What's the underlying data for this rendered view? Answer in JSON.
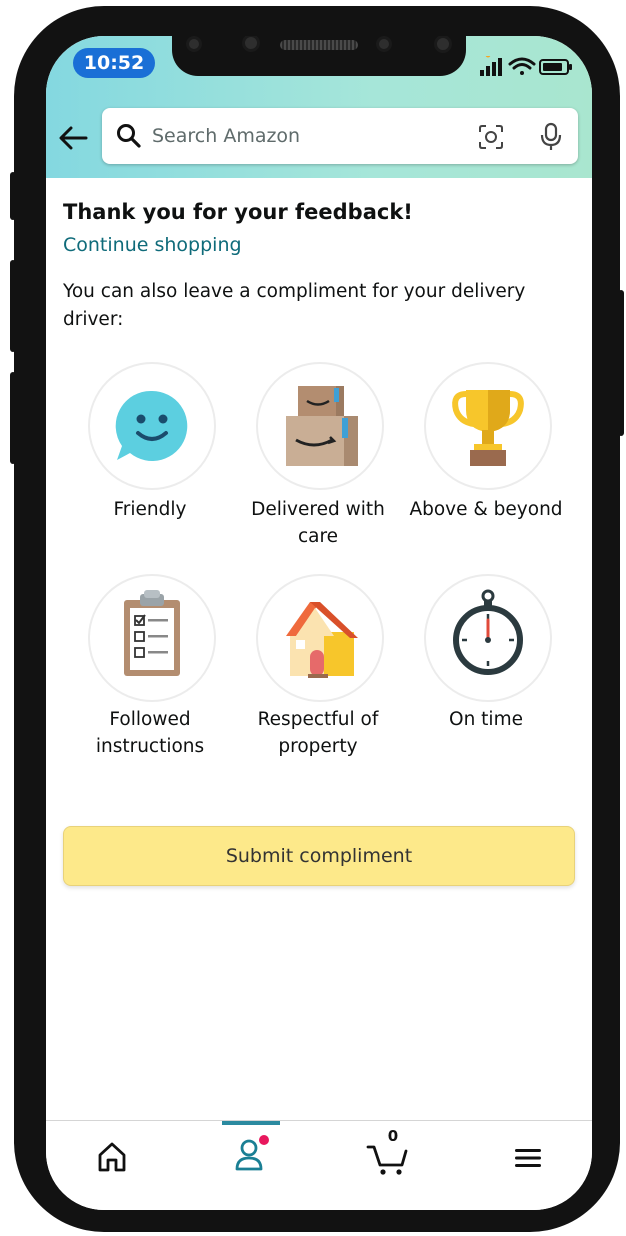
{
  "status_bar": {
    "time": "10:52"
  },
  "search": {
    "placeholder": "Search Amazon"
  },
  "content": {
    "title": "Thank you for your feedback!",
    "continue_link": "Continue shopping",
    "description": "You can also leave a compliment for your delivery driver:"
  },
  "compliments": [
    {
      "label": "Friendly",
      "icon": "smiley-icon"
    },
    {
      "label": "Delivered with care",
      "icon": "boxes-icon"
    },
    {
      "label": "Above & beyond",
      "icon": "trophy-icon"
    },
    {
      "label": "Followed instructions",
      "icon": "clipboard-checklist-icon"
    },
    {
      "label": "Respectful of property",
      "icon": "house-icon"
    },
    {
      "label": "On time",
      "icon": "stopwatch-icon"
    }
  ],
  "submit": {
    "label": "Submit compliment"
  },
  "bottom_nav": {
    "items": [
      "home-icon",
      "account-icon",
      "cart-icon",
      "menu-icon"
    ],
    "cart_count": "0",
    "active": "account"
  },
  "colors": {
    "header_gradient_start": "#84d8e0",
    "link": "#0f6b7a",
    "submit_bg": "#fde98a",
    "nav_indicator": "#2b8aa0",
    "notification_dot": "#e8175d"
  }
}
